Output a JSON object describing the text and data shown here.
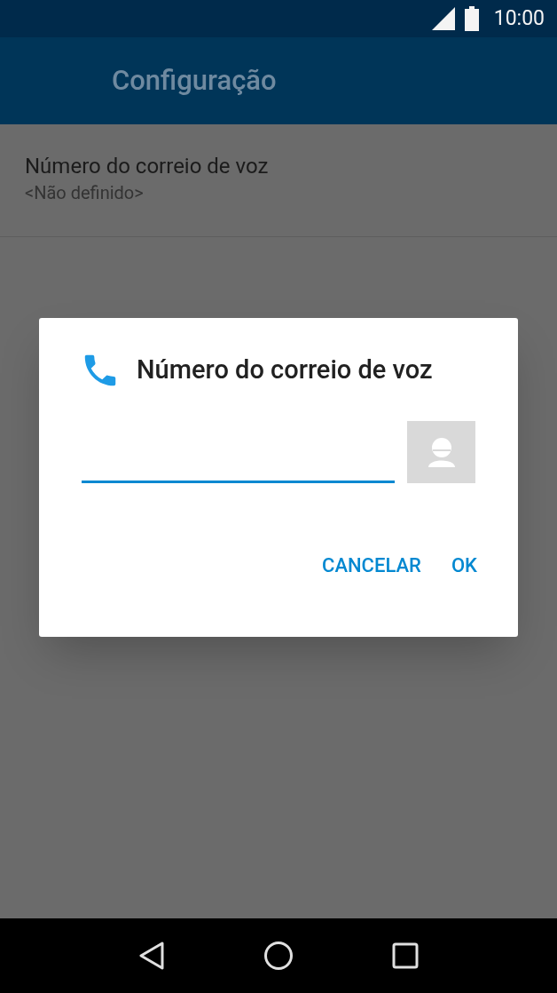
{
  "status_bar": {
    "time": "10:00"
  },
  "app_bar": {
    "title": "Configuração"
  },
  "settings": [
    {
      "title": "Número do correio de voz",
      "summary": "<Não definido>"
    }
  ],
  "dialog": {
    "title": "Número do correio de voz",
    "field": {
      "focused": true
    },
    "buttons": [
      "CANCELAR",
      "OK"
    ]
  }
}
